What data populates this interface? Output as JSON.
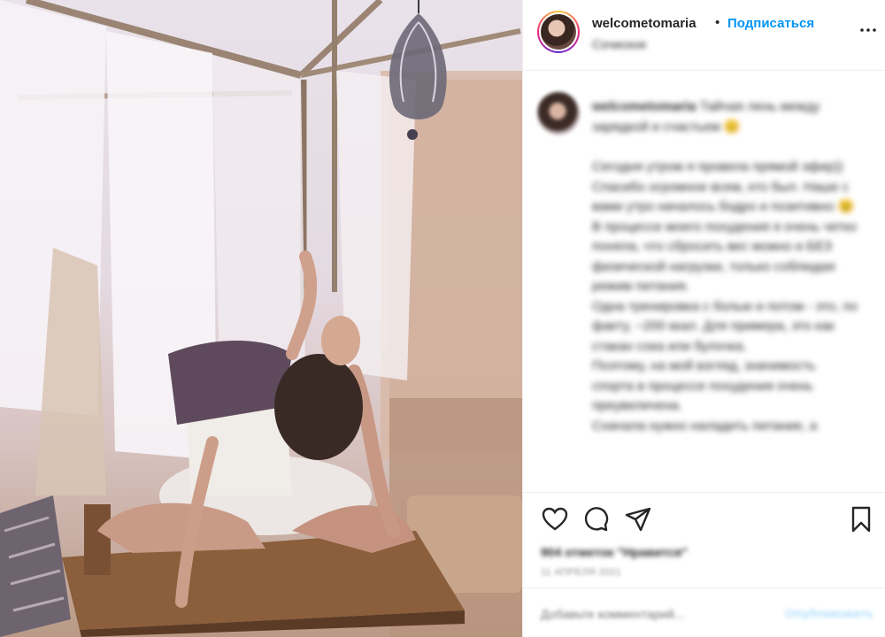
{
  "post": {
    "username": "welcometomaria",
    "separator": "•",
    "follow_label": "Подписаться",
    "location": "Сочиское",
    "photo_alt": "Woman in a yoga backbend pose on a wooden table under white canopy curtains"
  },
  "caption": {
    "author": "welcometomaria",
    "headline": "Тайчая лень между зарядкой и счастьем 😊",
    "body": [
      "Сегодня утром я провела прямой эфир)) Спасибо огромное всем, кто был. Наше с вами утро началось бодро и позитивно 😉 В процессе моего похудения я очень четко поняла, что сбросить вес можно и БЕЗ физической нагрузки, только соблюдая режим питания.",
      "Одна тренировка с болью и потом - это, по факту, ~200 ккал. Для примера, это как стакан сока или булочка.",
      "Поэтому, на мой взгляд, значимость спорта в процессе похудения очень преувеличена.",
      "Сначала нужно наладить питание, а"
    ]
  },
  "stats": {
    "likes": "904 отметок \"Нравится\"",
    "date": "11 АПРЕЛЯ 2021"
  },
  "comment_box": {
    "placeholder": "Добавьте комментарий...",
    "publish_label": "Опубликовать"
  },
  "icons": {
    "more": "more-options-icon",
    "like": "heart-icon",
    "comment": "comment-icon",
    "share": "share-icon",
    "save": "bookmark-icon"
  },
  "colors": {
    "accent": "#0095f6",
    "text": "#262626",
    "muted": "#8e8e8e",
    "border": "#efefef"
  }
}
